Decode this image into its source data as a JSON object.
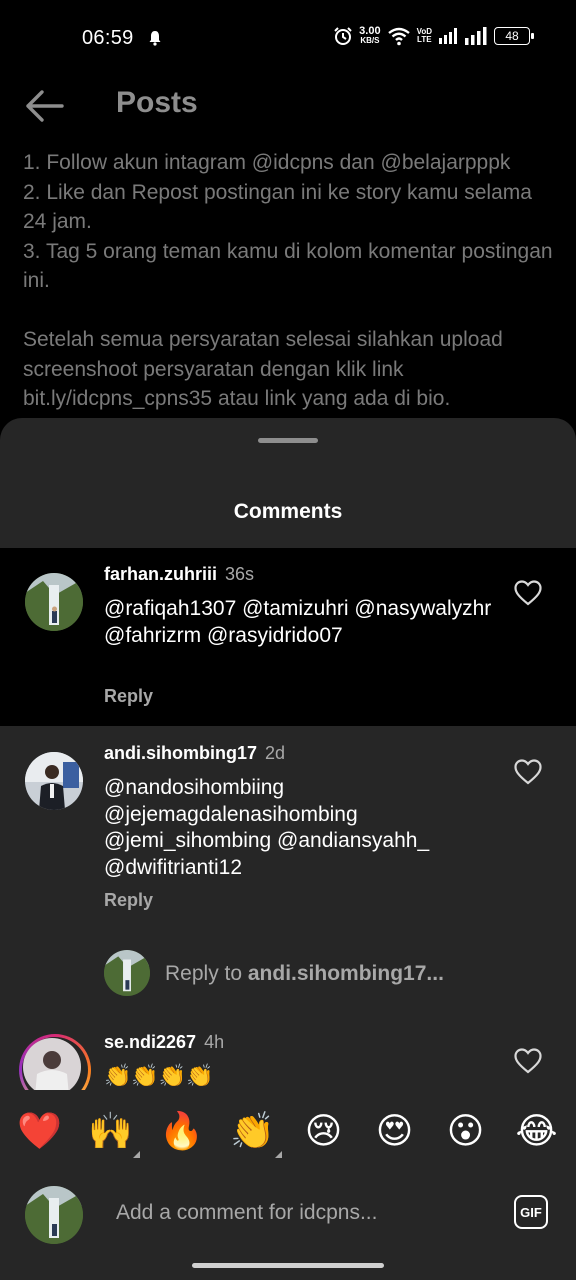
{
  "status_bar": {
    "time": "06:59",
    "net_speed_value": "3.00",
    "net_speed_unit": "KB/S",
    "volte_top": "VoD",
    "volte_bottom": "LTE",
    "battery": "48"
  },
  "header": {
    "title": "Posts"
  },
  "caption": "1. Follow akun intagram @idcpns dan @belajarpppk\n2. Like dan Repost postingan ini ke story kamu selama 24 jam.\n3. Tag 5 orang teman kamu di kolom komentar postingan ini.\n\nSetelah semua persyaratan selesai silahkan upload screenshoot persyaratan dengan klik link bit.ly/idcpns_cpns35 atau link yang ada di bio.",
  "sheet": {
    "title": "Comments"
  },
  "comments": [
    {
      "username": "farhan.zuhriii",
      "time": "36s",
      "text": "@rafiqah1307 @tamizuhri @nasywalyzhr @fahrizrm @rasyidrido07",
      "reply_label": "Reply"
    },
    {
      "username": "andi.sihombing17",
      "time": "2d",
      "text": "@nandosihombiing @jejemagdalenasihombing @jemi_sihombing @andiansyahh_ @dwifitrianti12",
      "reply_label": "Reply"
    },
    {
      "username": "se.ndi2267",
      "time": "4h",
      "text": "👏👏👏👏"
    }
  ],
  "reply_prompt": {
    "prefix": "Reply to ",
    "target": "andi.sihombing17..."
  },
  "emoji_bar": [
    "❤️",
    "🙌",
    "🔥",
    "👏",
    "😢",
    "😍",
    "😮",
    "😂"
  ],
  "composer": {
    "placeholder": "Add a comment for idcpns...",
    "gif_label": "GIF"
  },
  "colors": {
    "sheet_bg": "#262626",
    "secondary_text": "#a8a8a8"
  }
}
